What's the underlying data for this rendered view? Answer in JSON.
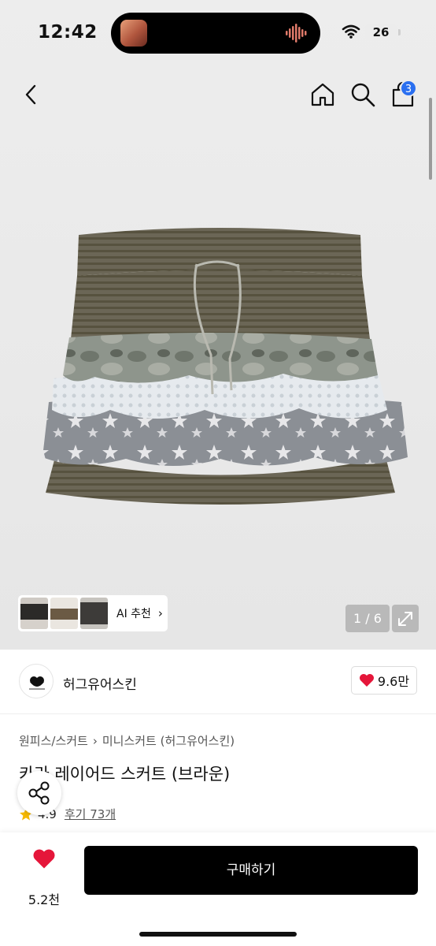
{
  "status_bar": {
    "time": "12:42",
    "battery": "26",
    "icons": [
      "music-album-thumb",
      "audio-waveform-icon",
      "wifi-icon",
      "battery-icon"
    ]
  },
  "nav": {
    "icons": [
      "back-chevron-icon",
      "home-icon",
      "search-icon",
      "shopping-bag-icon"
    ],
    "cart_badge": "3"
  },
  "gallery": {
    "ai_label": "AI 추천",
    "ai_chevron": "›",
    "counter": "1 / 6",
    "expand_icon": "expand-icon"
  },
  "brand": {
    "name": "허그유어스킨",
    "likes": "9.6만"
  },
  "product": {
    "breadcrumb": [
      "원피스/스커트",
      "미니스커트 (허그유어스킨)"
    ],
    "breadcrumb_sep": "›",
    "title": "카라 레이어드 스커트 (브라운)",
    "rating": "4.9",
    "reviews": "후기 73개"
  },
  "bottom_bar": {
    "wish_count": "5.2천",
    "buy_label": "구매하기"
  },
  "colors": {
    "accent_badge": "#2a6ff0",
    "heart": "#e5163a",
    "star": "#f5b800",
    "buy_button": "#000000"
  }
}
